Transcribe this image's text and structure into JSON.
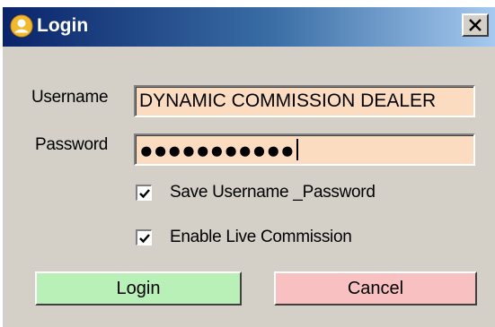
{
  "window": {
    "title": "Login",
    "icon": "user-icon",
    "close_icon": "close-icon"
  },
  "form": {
    "username_label": "Username",
    "username_value": "DYNAMIC COMMISSION DEALER",
    "password_label": "Password",
    "password_value": "●●●●●●●●●●●",
    "save_checkbox": {
      "label": "Save Username _Password",
      "checked": true
    },
    "live_checkbox": {
      "label": "Enable Live Commission",
      "checked": true
    }
  },
  "buttons": {
    "login_label": "Login",
    "cancel_label": "Cancel"
  },
  "colors": {
    "field_bg": "#fcdcc0",
    "login_bg": "#b8f0b8",
    "cancel_bg": "#f8c0c0",
    "titlebar_start": "#0a246a",
    "titlebar_end": "#a6caf0"
  }
}
